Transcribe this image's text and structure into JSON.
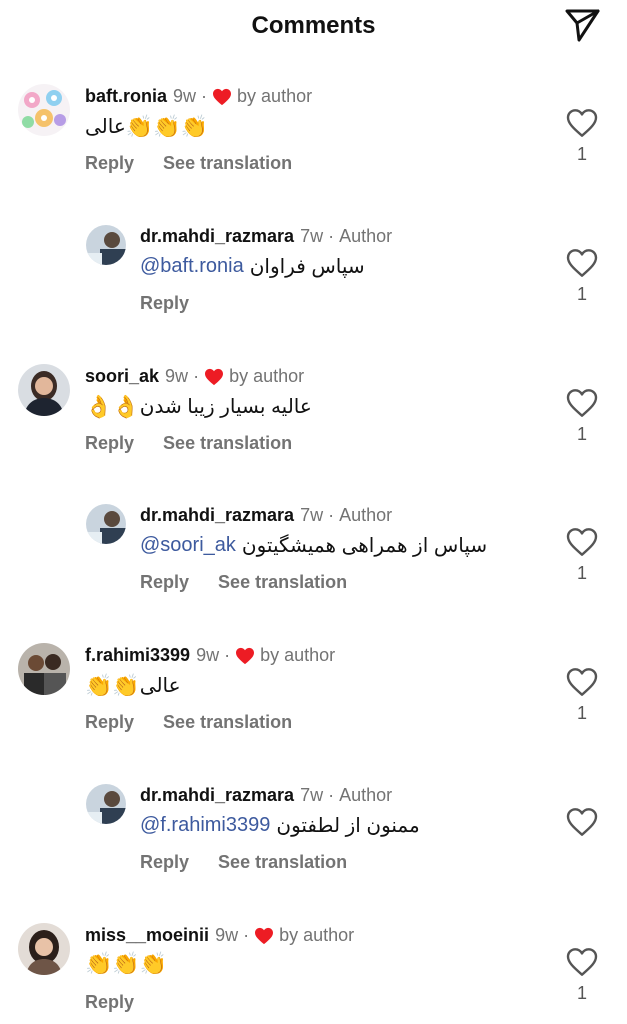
{
  "header": {
    "title": "Comments",
    "send_icon": "paper-plane-icon"
  },
  "comments": [
    {
      "username": "baft.ronia",
      "time": "9w",
      "liked_by_author": true,
      "by_author_label": "by author",
      "text": "عالی",
      "emoji": "👏👏👏",
      "actions": {
        "reply": "Reply",
        "translate": "See translation"
      },
      "likes": "1",
      "reply": {
        "username": "dr.mahdi_razmara",
        "time": "7w",
        "author_label": "Author",
        "mention": "@baft.ronia",
        "text": "سپاس فراوان",
        "actions": {
          "reply": "Reply"
        },
        "likes": "1"
      }
    },
    {
      "username": "soori_ak",
      "time": "9w",
      "liked_by_author": true,
      "by_author_label": "by author",
      "text": "عالیه بسیار زیبا شدن",
      "emoji": "👌👌",
      "actions": {
        "reply": "Reply",
        "translate": "See translation"
      },
      "likes": "1",
      "reply": {
        "username": "dr.mahdi_razmara",
        "time": "7w",
        "author_label": "Author",
        "mention": "@soori_ak",
        "text": "سپاس از همراهی همیشگیتون",
        "actions": {
          "reply": "Reply",
          "translate": "See translation"
        },
        "likes": "1"
      }
    },
    {
      "username": "f.rahimi3399",
      "time": "9w",
      "liked_by_author": true,
      "by_author_label": "by author",
      "text": "عالی",
      "emoji": "👏👏",
      "actions": {
        "reply": "Reply",
        "translate": "See translation"
      },
      "likes": "1",
      "reply": {
        "username": "dr.mahdi_razmara",
        "time": "7w",
        "author_label": "Author",
        "mention": "@f.rahimi3399",
        "text": "ممنون از لطفتون",
        "actions": {
          "reply": "Reply",
          "translate": "See translation"
        },
        "likes": ""
      }
    },
    {
      "username": "miss__moeinii",
      "time": "9w",
      "liked_by_author": true,
      "by_author_label": "by author",
      "text": "",
      "emoji": "👏👏👏",
      "actions": {
        "reply": "Reply"
      },
      "likes": "1"
    }
  ],
  "colors": {
    "heart_red": "#ed1c24",
    "mention_blue": "#3d5a9e",
    "muted_gray": "#737373"
  }
}
